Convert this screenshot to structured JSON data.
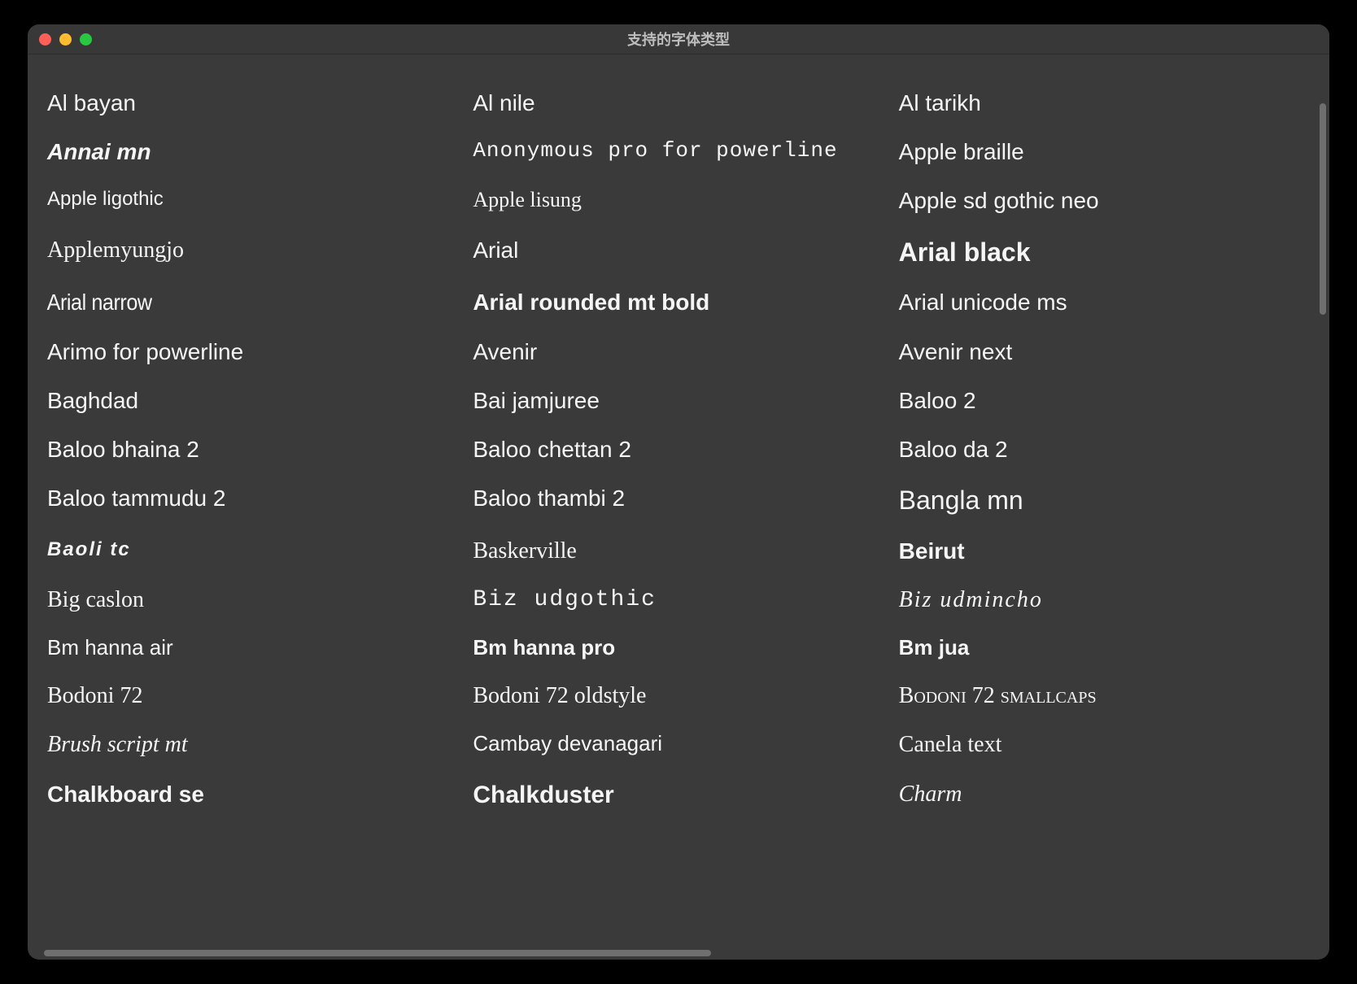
{
  "window": {
    "title": "支持的字体类型"
  },
  "fonts": [
    {
      "label": "Al bayan",
      "style": ""
    },
    {
      "label": "Al nile",
      "style": ""
    },
    {
      "label": "Al tarikh",
      "style": ""
    },
    {
      "label": "Annai mn",
      "style": "italic bold"
    },
    {
      "label": "Anonymous pro for powerline",
      "style": "mono fs26"
    },
    {
      "label": "Apple braille",
      "style": ""
    },
    {
      "label": "Apple ligothic",
      "style": "fs24"
    },
    {
      "label": "Apple lisung",
      "style": "serif fs26"
    },
    {
      "label": "Apple sd gothic neo",
      "style": ""
    },
    {
      "label": "Applemyungjo",
      "style": "serif"
    },
    {
      "label": "Arial",
      "style": ""
    },
    {
      "label": "Arial black",
      "style": "xbold fs32"
    },
    {
      "label": "Arial narrow",
      "style": "cond"
    },
    {
      "label": "Arial rounded mt bold",
      "style": "rounded"
    },
    {
      "label": "Arial unicode ms",
      "style": ""
    },
    {
      "label": "Arimo for powerline",
      "style": ""
    },
    {
      "label": "Avenir",
      "style": ""
    },
    {
      "label": "Avenir next",
      "style": ""
    },
    {
      "label": "Baghdad",
      "style": ""
    },
    {
      "label": "Bai jamjuree",
      "style": ""
    },
    {
      "label": "Baloo 2",
      "style": ""
    },
    {
      "label": "Baloo bhaina 2",
      "style": ""
    },
    {
      "label": "Baloo chettan 2",
      "style": ""
    },
    {
      "label": "Baloo da 2",
      "style": ""
    },
    {
      "label": "Baloo tammudu 2",
      "style": ""
    },
    {
      "label": "Baloo thambi 2",
      "style": ""
    },
    {
      "label": "Bangla mn",
      "style": "fs32"
    },
    {
      "label": "Baoli tc",
      "style": "bold italic wide fs24"
    },
    {
      "label": "Baskerville",
      "style": "serif"
    },
    {
      "label": "Beirut",
      "style": "bold"
    },
    {
      "label": "Big caslon",
      "style": "serif"
    },
    {
      "label": "Biz udgothic",
      "style": "mono wide"
    },
    {
      "label": "Biz udmincho",
      "style": "serif italic wide"
    },
    {
      "label": "Bm hanna air",
      "style": "thin fs26"
    },
    {
      "label": "Bm hanna pro",
      "style": "bold fs26"
    },
    {
      "label": "Bm jua",
      "style": "bold fs26"
    },
    {
      "label": "Bodoni 72",
      "style": "serif"
    },
    {
      "label": "Bodoni 72 oldstyle",
      "style": "serif"
    },
    {
      "label": "Bodoni 72 smallcaps",
      "style": "smallcaps"
    },
    {
      "label": "Brush script mt",
      "style": "script"
    },
    {
      "label": "Cambay devanagari",
      "style": "fs26"
    },
    {
      "label": "Canela text",
      "style": "serif"
    },
    {
      "label": "Chalkboard se",
      "style": "bold"
    },
    {
      "label": "Chalkduster",
      "style": "bold fs30"
    },
    {
      "label": "Charm",
      "style": "serif italic"
    }
  ]
}
